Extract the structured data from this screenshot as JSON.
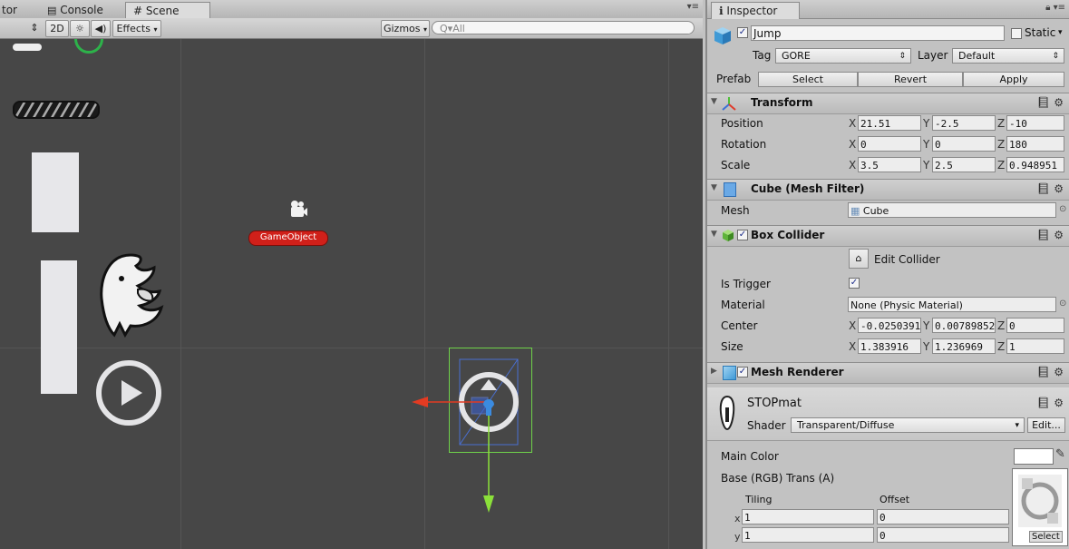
{
  "tabs": {
    "cut_label": "tor",
    "console": "Console",
    "scene": "Scene"
  },
  "scene_toolbar": {
    "mode_2d": "2D",
    "effects": "Effects",
    "gizmos": "Gizmos",
    "search_placeholder": "All",
    "search_prefix": "Q▾"
  },
  "scene": {
    "gameobject_label": "GameObject"
  },
  "inspector": {
    "tab_title": "Inspector",
    "object_name": "Jump",
    "static_label": "Static",
    "tag_label": "Tag",
    "tag_value": "GORE",
    "layer_label": "Layer",
    "layer_value": "Default",
    "prefab_label": "Prefab",
    "prefab_select": "Select",
    "prefab_revert": "Revert",
    "prefab_apply": "Apply",
    "transform": {
      "title": "Transform",
      "position_label": "Position",
      "rotation_label": "Rotation",
      "scale_label": "Scale",
      "axis_x": "X",
      "axis_y": "Y",
      "axis_z": "Z",
      "position": {
        "x": "21.51",
        "y": "-2.5",
        "z": "-10"
      },
      "rotation": {
        "x": "0",
        "y": "0",
        "z": "180"
      },
      "scale": {
        "x": "3.5",
        "y": "2.5",
        "z": "0.948951"
      }
    },
    "mesh_filter": {
      "title": "Cube (Mesh Filter)",
      "mesh_label": "Mesh",
      "mesh_value": "Cube"
    },
    "box_collider": {
      "title": "Box Collider",
      "edit_collider": "Edit Collider",
      "is_trigger_label": "Is Trigger",
      "material_label": "Material",
      "material_value": "None (Physic Material)",
      "center_label": "Center",
      "size_label": "Size",
      "center": {
        "x": "-0.0250391",
        "y": "0.00789852",
        "z": "0"
      },
      "size": {
        "x": "1.383916",
        "y": "1.236969",
        "z": "1"
      }
    },
    "mesh_renderer": {
      "title": "Mesh Renderer"
    },
    "material": {
      "name": "STOPmat",
      "shader_label": "Shader",
      "shader_value": "Transparent/Diffuse",
      "edit_button": "Edit...",
      "main_color_label": "Main Color",
      "base_label": "Base (RGB) Trans (A)",
      "tiling_label": "Tiling",
      "offset_label": "Offset",
      "row_x": "x",
      "row_y": "y",
      "tiling": {
        "x": "1",
        "y": "1"
      },
      "offset": {
        "x": "0",
        "y": "0"
      },
      "texture_select": "Select"
    }
  },
  "colors": {
    "scene_bg": "#474747",
    "panel_bg": "#c2c2c2",
    "selection_box": "#6fd24a",
    "gameobject_badge": "#d0201a",
    "axis_x": "#e33b22",
    "axis_y": "#8be03a"
  }
}
